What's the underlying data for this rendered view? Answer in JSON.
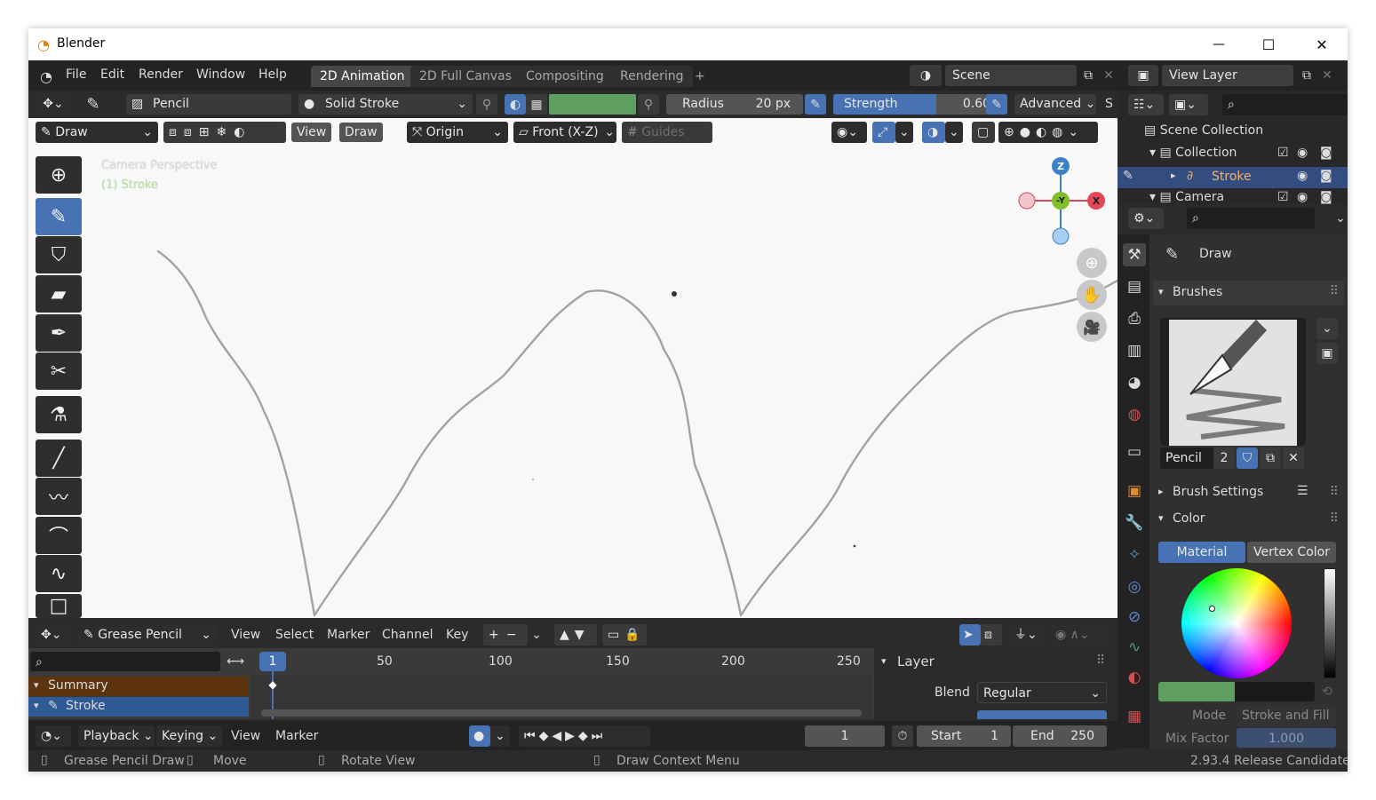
{
  "window": {
    "title": "Blender",
    "min": "—",
    "max": "☐",
    "close": "✕"
  },
  "menu": [
    "File",
    "Edit",
    "Render",
    "Window",
    "Help"
  ],
  "workspaces": [
    {
      "label": "2D Animation",
      "active": true
    },
    {
      "label": "2D Full Canvas"
    },
    {
      "label": "Compositing"
    },
    {
      "label": "Rendering"
    }
  ],
  "add_tab": "+",
  "scene": {
    "label": "Scene"
  },
  "view_layer": {
    "label": "View Layer"
  },
  "toolheader": {
    "brush": "Pencil",
    "material": "Solid Stroke",
    "radius_label": "Radius",
    "radius_value": "20 px",
    "strength_label": "Strength",
    "strength_value": "0.600",
    "advanced": "Advanced",
    "cut": "S"
  },
  "viewheader": {
    "mode": "Draw",
    "view": "View",
    "draw": "Draw",
    "origin": "Origin",
    "plane": "Front (X-Z)",
    "guides": "Guides"
  },
  "viewport": {
    "overlay1": "Camera Perspective",
    "overlay2": "(1) Stroke",
    "stroke_color": "#a3a3a3"
  },
  "gizmo": {
    "z": "Z",
    "y": "-Y",
    "x": "X"
  },
  "outliner": {
    "root": "Scene Collection",
    "items": [
      {
        "label": "Collection"
      },
      {
        "label": "Stroke"
      },
      {
        "label": "Camera"
      }
    ]
  },
  "props": {
    "tool": "Draw",
    "brushes": "Brushes",
    "brush_name": "Pencil",
    "brush_users": "2",
    "brush_settings": "Brush Settings",
    "color": "Color",
    "material_tab": "Material",
    "vertex_tab": "Vertex Color",
    "mode_label": "Mode",
    "mode_value": "Stroke and Fill",
    "mix_label": "Mix Factor",
    "mix_value": "1.000",
    "mix_fraction": 1.0
  },
  "dopesheet": {
    "mode": "Grease Pencil",
    "menus": [
      "View",
      "Select",
      "Marker",
      "Channel",
      "Key"
    ],
    "frame": "1",
    "ruler": [
      "50",
      "100",
      "150",
      "200",
      "250"
    ],
    "summary": "Summary",
    "stroke": "Stroke",
    "layer_panel": "Layer",
    "blend_label": "Blend",
    "blend_value": "Regular"
  },
  "timeline": {
    "playback": "Playback",
    "keying": "Keying",
    "view": "View",
    "marker": "Marker",
    "current": "1",
    "start_label": "Start",
    "start": "1",
    "end_label": "End",
    "end": "250"
  },
  "status": {
    "items": [
      "Grease Pencil Draw",
      "Move",
      "Rotate View",
      "Draw Context Menu"
    ],
    "version": "2.93.4 Release Candidate"
  },
  "colors": {
    "accent": "#4772b3",
    "header": "#232323",
    "viewport": "#f8f8f8",
    "green": "#5e9e5e"
  }
}
